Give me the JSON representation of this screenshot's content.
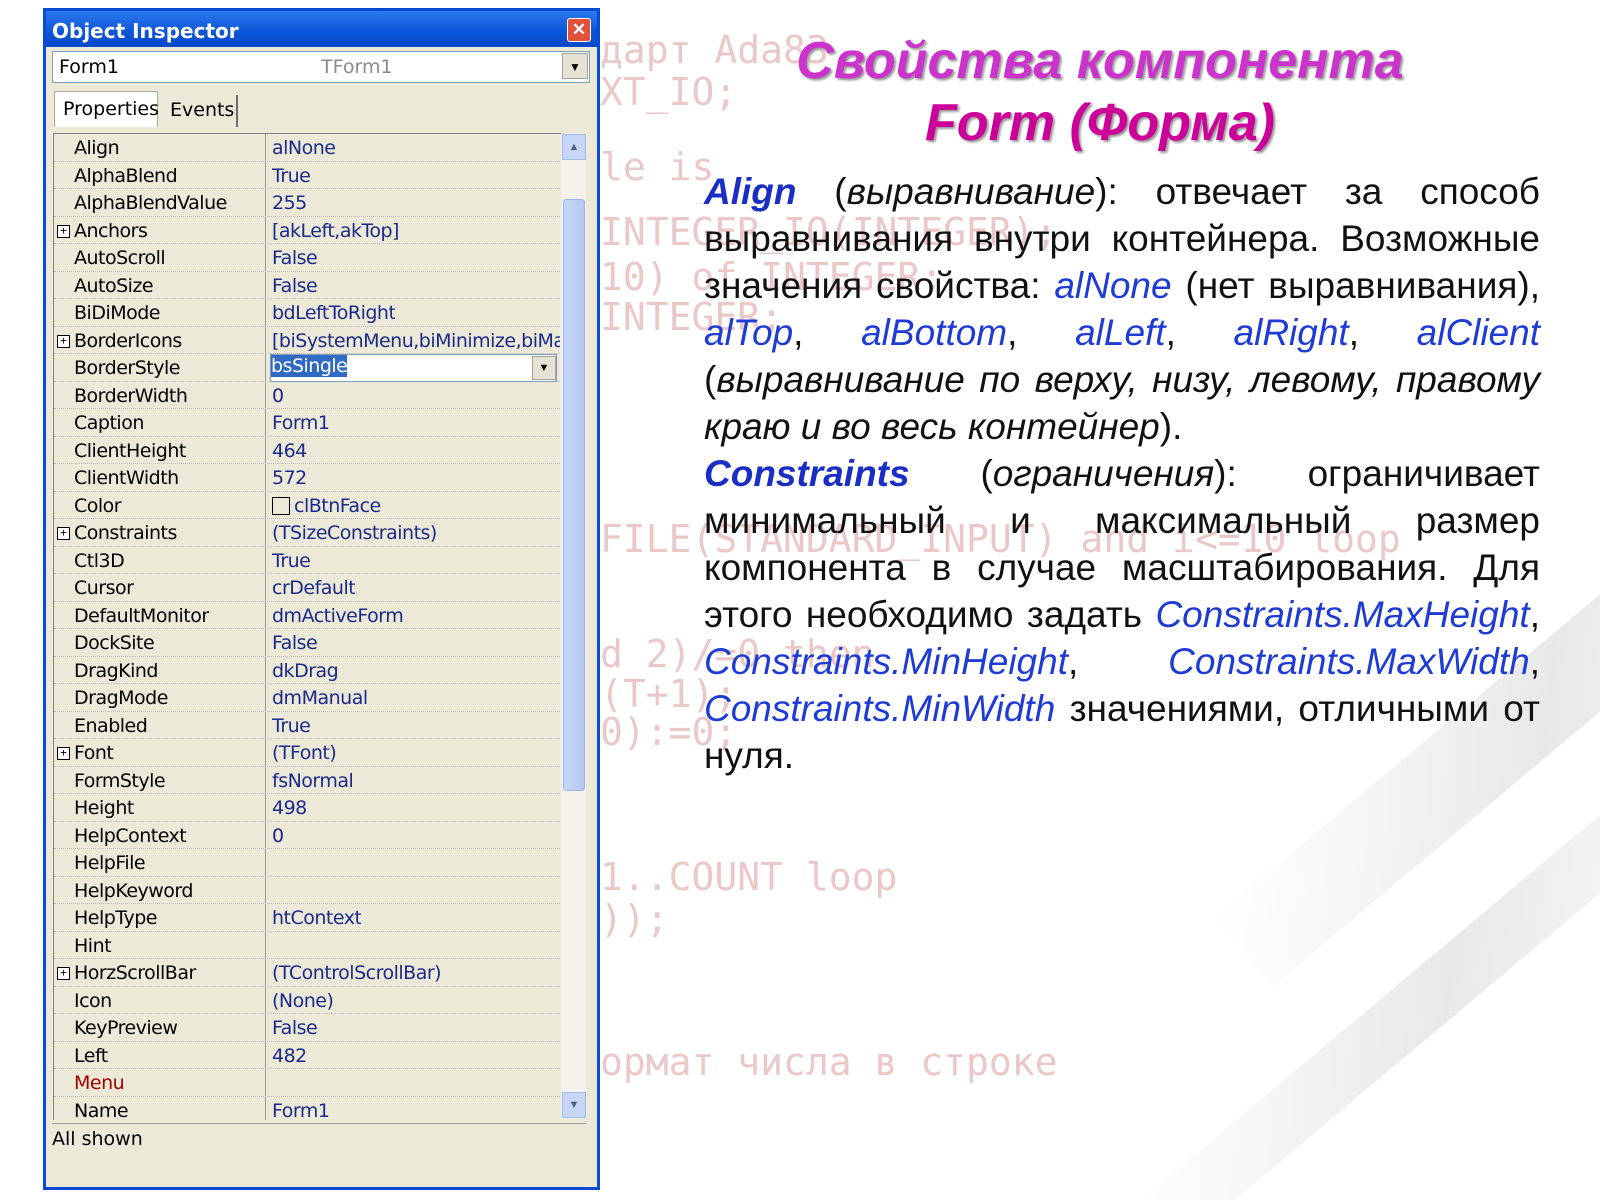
{
  "background_code": [
    "дарт Ada83",
    "XT_IO;",
    "le is",
    "INTEGER_IO(INTEGER);",
    "10) of INTEGER;",
    "INTEGER;",
    "FILE(STANDARD_INPUT) and i<=10 loop",
    "d 2)/=0 then",
    "(T+1);",
    "0):=0;",
    "1..COUNT loop",
    "));",
    "ормат числа в строке"
  ],
  "inspector": {
    "title": "Object Inspector",
    "close_icon": "close-icon",
    "object_name": "Form1",
    "object_type": "TForm1",
    "tabs": [
      "Properties",
      "Events"
    ],
    "status": "All shown",
    "properties": [
      {
        "name": "Align",
        "value": "alNone"
      },
      {
        "name": "AlphaBlend",
        "value": "True"
      },
      {
        "name": "AlphaBlendValue",
        "value": "255"
      },
      {
        "name": "Anchors",
        "value": "[akLeft,akTop]",
        "expandable": true
      },
      {
        "name": "AutoScroll",
        "value": "False"
      },
      {
        "name": "AutoSize",
        "value": "False"
      },
      {
        "name": "BiDiMode",
        "value": "bdLeftToRight"
      },
      {
        "name": "BorderIcons",
        "value": "[biSystemMenu,biMinimize,biMaximi",
        "expandable": true
      },
      {
        "name": "BorderStyle",
        "value": "bsSingle",
        "selected": true
      },
      {
        "name": "BorderWidth",
        "value": "0"
      },
      {
        "name": "Caption",
        "value": "Form1"
      },
      {
        "name": "ClientHeight",
        "value": "464"
      },
      {
        "name": "ClientWidth",
        "value": "572"
      },
      {
        "name": "Color",
        "value": "clBtnFace",
        "swatch": true
      },
      {
        "name": "Constraints",
        "value": "(TSizeConstraints)",
        "expandable": true
      },
      {
        "name": "Ctl3D",
        "value": "True"
      },
      {
        "name": "Cursor",
        "value": "crDefault"
      },
      {
        "name": "DefaultMonitor",
        "value": "dmActiveForm"
      },
      {
        "name": "DockSite",
        "value": "False"
      },
      {
        "name": "DragKind",
        "value": "dkDrag"
      },
      {
        "name": "DragMode",
        "value": "dmManual"
      },
      {
        "name": "Enabled",
        "value": "True"
      },
      {
        "name": "Font",
        "value": "(TFont)",
        "expandable": true
      },
      {
        "name": "FormStyle",
        "value": "fsNormal"
      },
      {
        "name": "Height",
        "value": "498"
      },
      {
        "name": "HelpContext",
        "value": "0"
      },
      {
        "name": "HelpFile",
        "value": ""
      },
      {
        "name": "HelpKeyword",
        "value": ""
      },
      {
        "name": "HelpType",
        "value": "htContext"
      },
      {
        "name": "Hint",
        "value": ""
      },
      {
        "name": "HorzScrollBar",
        "value": "(TControlScrollBar)",
        "expandable": true
      },
      {
        "name": "Icon",
        "value": "(None)"
      },
      {
        "name": "KeyPreview",
        "value": "False"
      },
      {
        "name": "Left",
        "value": "482"
      },
      {
        "name": "Menu",
        "value": "",
        "highlight": true
      },
      {
        "name": "Name",
        "value": "Form1"
      }
    ]
  },
  "slide": {
    "title_line1": "Свойства компонента",
    "title_line2": "Form (Форма)",
    "p1": {
      "kw": "Align",
      "kw_gloss": "выравнивание",
      "t1": "): отвечает за способ выравнивания внутри контейнера. Возможные значения свойства: ",
      "v1": "alNone",
      "t2": " (нет выравнивания), ",
      "v2": "alTop",
      "v3": "alBottom",
      "v4": "alLeft",
      "v5": "alRight",
      "v6": "alClient",
      "gloss2": "выравнивание по верху, низу, левому, правому краю и во весь контейнер",
      "t3": ")."
    },
    "p2": {
      "kw": "Constraints",
      "kw_gloss": "ограничения",
      "t1": "): ограничивает минимальный и максимальный размер компонента в случае масштабирования. Для этого необходимо задать ",
      "v1": "Constraints.MaxHeight",
      "v2": "Constraints.MinHeight",
      "v3": "Constraints.MaxWidth",
      "v4": "Constraints.MinWidth",
      "t2": " значениями, отличными от нуля."
    }
  }
}
